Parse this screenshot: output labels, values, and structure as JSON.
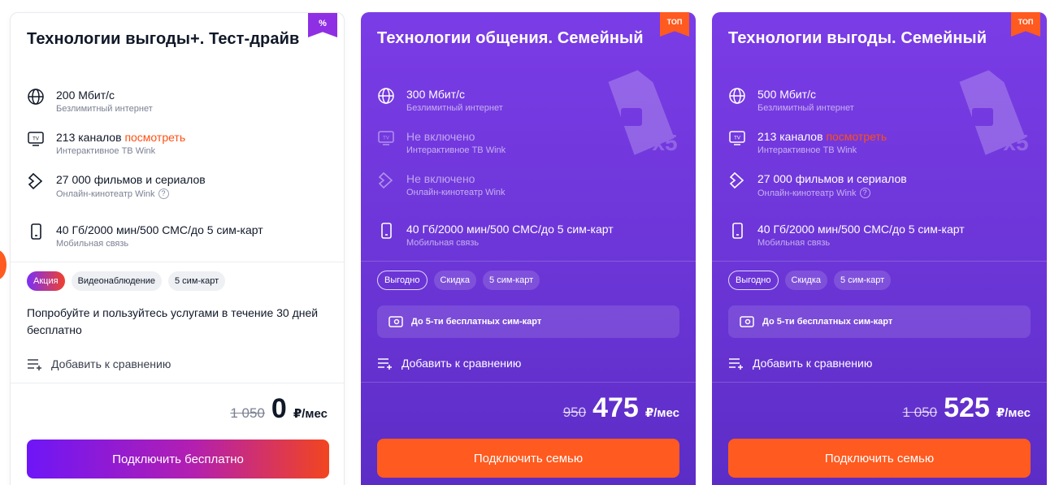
{
  "cards": [
    {
      "ribbon": "%",
      "title": "Технологии выгоды+. Тест-драйв",
      "features": [
        {
          "icon": "globe-icon",
          "main": "200 Мбит/с",
          "sub": "Безлимитный интернет"
        },
        {
          "icon": "tv-icon",
          "main": "213 каналов",
          "link": "посмотреть",
          "sub": "Интерактивное ТВ Wink"
        },
        {
          "icon": "play-icon",
          "main": "27 000 фильмов и сериалов",
          "sub": "Онлайн-кинотеатр Wink",
          "help": "?"
        },
        {
          "icon": "phone-icon",
          "main": "40 Гб/2000 мин/500 СМС/до 5 сим-карт",
          "sub": "Мобильная связь"
        }
      ],
      "tags": [
        "Акция",
        "Видеонаблюдение",
        "5 сим-карт"
      ],
      "description": "Попробуйте и пользуйтесь услугами в течение 30 дней бесплатно",
      "compare": "Добавить к сравнению",
      "old_price": "1 050",
      "price": "0",
      "unit": "₽/мес",
      "cta": "Подключить бесплатно"
    },
    {
      "ribbon": "ТОП",
      "title": "Технологии общения. Семейный",
      "sim_badge": "x5",
      "features": [
        {
          "icon": "globe-icon",
          "main": "300 Мбит/с",
          "sub": "Безлимитный интернет"
        },
        {
          "icon": "tv-icon",
          "main": "Не включено",
          "sub": "Интерактивное ТВ Wink"
        },
        {
          "icon": "play-icon",
          "main": "Не включено",
          "sub": "Онлайн-кинотеатр Wink"
        },
        {
          "icon": "phone-icon",
          "main": "40 Гб/2000 мин/500 СМС/до 5 сим-карт",
          "sub": "Мобильная связь"
        }
      ],
      "tags": [
        "Выгодно",
        "Скидка",
        "5 сим-карт"
      ],
      "benefit": "До 5-ти бесплатных сим-карт",
      "compare": "Добавить к сравнению",
      "old_price": "950",
      "price": "475",
      "unit": "₽/мес",
      "cta": "Подключить семью"
    },
    {
      "ribbon": "ТОП",
      "title": "Технологии выгоды. Семейный",
      "sim_badge": "x5",
      "features": [
        {
          "icon": "globe-icon",
          "main": "500 Мбит/с",
          "sub": "Безлимитный интернет"
        },
        {
          "icon": "tv-icon",
          "main": "213 каналов",
          "link": "посмотреть",
          "sub": "Интерактивное ТВ Wink"
        },
        {
          "icon": "play-icon",
          "main": "27 000 фильмов и сериалов",
          "sub": "Онлайн-кинотеатр Wink",
          "help": "?"
        },
        {
          "icon": "phone-icon",
          "main": "40 Гб/2000 мин/500 СМС/до 5 сим-карт",
          "sub": "Мобильная связь"
        }
      ],
      "tags": [
        "Выгодно",
        "Скидка",
        "5 сим-карт"
      ],
      "benefit": "До 5-ти бесплатных сим-карт",
      "compare": "Добавить к сравнению",
      "old_price": "1 050",
      "price": "525",
      "unit": "₽/мес",
      "cta": "Подключить семью"
    }
  ],
  "colors": {
    "accent_orange": "#ff5a1f",
    "purple_card": "#7a3ce6",
    "link": "#ff4f12"
  }
}
